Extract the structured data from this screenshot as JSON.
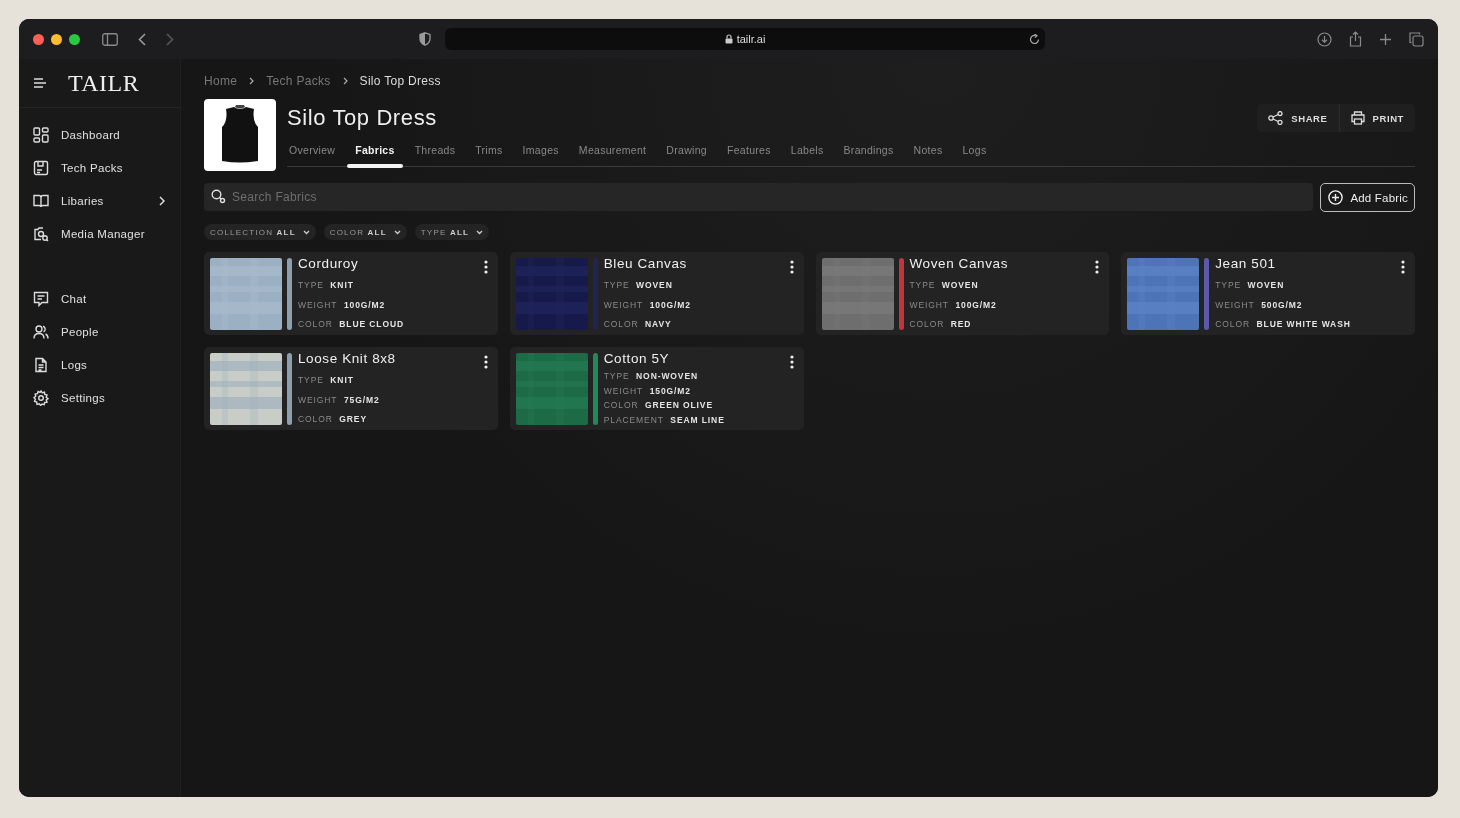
{
  "browser": {
    "url": "tailr.ai"
  },
  "sidebar": {
    "logo": "TAILR",
    "groups": [
      [
        {
          "label": "Dashboard",
          "kind": "dashboard",
          "submenu": false
        },
        {
          "label": "Tech Packs",
          "kind": "techpack",
          "submenu": false
        },
        {
          "label": "Libaries",
          "kind": "book",
          "submenu": true
        },
        {
          "label": "Media Manager",
          "kind": "media",
          "submenu": false
        }
      ],
      [
        {
          "label": "Chat",
          "kind": "chat",
          "submenu": false
        },
        {
          "label": "People",
          "kind": "people",
          "submenu": false
        },
        {
          "label": "Logs",
          "kind": "doc",
          "submenu": false
        },
        {
          "label": "Settings",
          "kind": "gear",
          "submenu": false
        }
      ]
    ]
  },
  "breadcrumb": [
    "Home",
    "Tech Packs",
    "Silo Top Dress"
  ],
  "product": {
    "title": "Silo Top Dress",
    "actions": [
      {
        "label": "SHARE",
        "kind": "share"
      },
      {
        "label": "PRINT",
        "kind": "print"
      }
    ]
  },
  "tabs": [
    {
      "label": "Overview",
      "selected": false
    },
    {
      "label": "Fabrics",
      "selected": true
    },
    {
      "label": "Threads",
      "selected": false
    },
    {
      "label": "Trims",
      "selected": false
    },
    {
      "label": "Images",
      "selected": false
    },
    {
      "label": "Measurement",
      "selected": false
    },
    {
      "label": "Drawing",
      "selected": false
    },
    {
      "label": "Features",
      "selected": false
    },
    {
      "label": "Labels",
      "selected": false
    },
    {
      "label": "Brandings",
      "selected": false
    },
    {
      "label": "Notes",
      "selected": false
    },
    {
      "label": "Logs",
      "selected": false
    }
  ],
  "search": {
    "placeholder": "Search Fabrics"
  },
  "add_button": "Add Fabric",
  "filters": [
    {
      "label": "COLLECTION",
      "value": "ALL"
    },
    {
      "label": "COLOR",
      "value": "ALL"
    },
    {
      "label": "TYPE",
      "value": "ALL"
    }
  ],
  "fabrics": [
    {
      "name": "Corduroy",
      "color": "#8a9fb0",
      "attributes": [
        {
          "label": "TYPE",
          "value": "KNIT"
        },
        {
          "label": "WEIGHT",
          "value": "100G/M2"
        },
        {
          "label": "COLOR",
          "value": "BLUE CLOUD"
        }
      ]
    },
    {
      "name": "Bleu Canvas",
      "color": "#1f2550",
      "attributes": [
        {
          "label": "TYPE",
          "value": "WOVEN"
        },
        {
          "label": "WEIGHT",
          "value": "100G/M2"
        },
        {
          "label": "COLOR",
          "value": "NAVY"
        }
      ]
    },
    {
      "name": "Woven Canvas",
      "color": "#c0363a",
      "attributes": [
        {
          "label": "TYPE",
          "value": "WOVEN"
        },
        {
          "label": "WEIGHT",
          "value": "100G/M2"
        },
        {
          "label": "COLOR",
          "value": "RED"
        }
      ]
    },
    {
      "name": "Jean 501",
      "color": "#5a5aa8",
      "attributes": [
        {
          "label": "TYPE",
          "value": "WOVEN"
        },
        {
          "label": "WEIGHT",
          "value": "500G/M2"
        },
        {
          "label": "COLOR",
          "value": "BLUE WHITE WASH"
        }
      ]
    },
    {
      "name": "Loose Knit 8x8",
      "color": "#8a9fb0",
      "attributes": [
        {
          "label": "TYPE",
          "value": "KNIT"
        },
        {
          "label": "WEIGHT",
          "value": "75G/M2"
        },
        {
          "label": "COLOR",
          "value": "GREY"
        }
      ]
    },
    {
      "name": "Cotton 5Y",
      "color": "#1f8a5a",
      "attributes": [
        {
          "label": "TYPE",
          "value": "NON-WOVEN"
        },
        {
          "label": "WEIGHT",
          "value": "150G/M2"
        },
        {
          "label": "COLOR",
          "value": "GREEN OLIVE"
        },
        {
          "label": "PLACEMENT",
          "value": "SEAM LINE"
        }
      ]
    }
  ]
}
